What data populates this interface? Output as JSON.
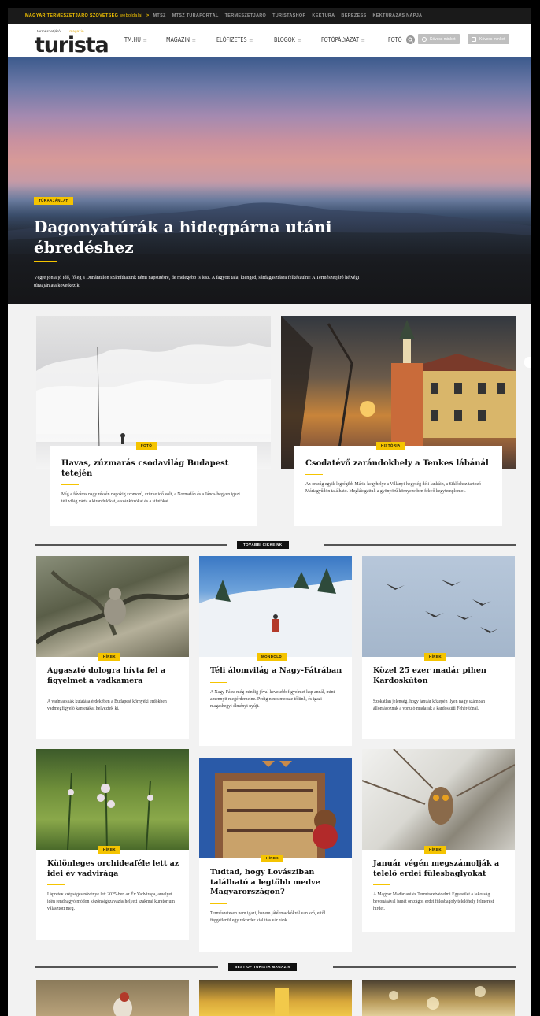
{
  "topbar": {
    "brand": "MAGYAR TERMÉSZETJÁRÓ SZÖVETSÉG",
    "brand_suffix": "weboldalai",
    "separator": ">",
    "links": [
      "MTSZ",
      "MTSZ TÚRAPORTÁL",
      "TERMÉSZETJÁRÓ",
      "TURISTASHOP",
      "KÉKTÚRA",
      "BEREZESS",
      "KÉKTÚRÁZÁS NAPJA"
    ]
  },
  "header": {
    "logo_tagline": "természetjáró",
    "logo_tagline_mag": "magazin",
    "logo_word": "turista",
    "nav": [
      {
        "label": "TM.HU",
        "chevron": "≡"
      },
      {
        "label": "MAGAZIN",
        "chevron": "≡"
      },
      {
        "label": "ELŐFIZETÉS",
        "chevron": "≡"
      },
      {
        "label": "BLOGOK",
        "chevron": "≡"
      },
      {
        "label": "FOTÓPÁLYÁZAT",
        "chevron": "≡"
      },
      {
        "label": "FOTÓ",
        "chevron": ""
      }
    ],
    "social": [
      {
        "label": "Kövess minket",
        "icon": "facebook-icon"
      },
      {
        "label": "Kövess minket",
        "icon": "instagram-icon"
      }
    ]
  },
  "hero": {
    "badge": "TÚRAAJÁNLAT",
    "title": "Dagonyatúrák a hidegpárna utáni ébredéshez",
    "lead": "Végre jön a jó idő, főleg a Dunántúlon számíthatunk némi napsütésre, de melegebb is lesz. A fagyott talaj kienged, sárdagasztásra felkészülni! A Természetjáró hétvégi túraajánlata következik."
  },
  "featured": [
    {
      "badge": "FOTÓ",
      "title": "Havas, zúzmarás csodavilág Budapest tetején",
      "lead": "Míg a főváros nagy részén napokig szomorú, szürke idő volt, a Normafán és a János-hegyen igazi téli világ várta a kirándulókat, a szánkózókat és a sífutókat."
    },
    {
      "badge": "HISTÓRIA",
      "title": "Csodatévő zarándokhely a Tenkes lábánál",
      "lead": "Az ország egyik legrégibb Mária-kegyhelye a Villányi-hegység déli lankáin, a Siklóshoz tartozó Máriagyűdön található. Meglátogattuk a gyönyörű környezetben fekvő kegytemplomot."
    }
  ],
  "section1": {
    "label": "TOVÁBBI CIKKEINK"
  },
  "grid": [
    {
      "badge": "HÍREK",
      "title": "Aggasztó dologra hívta fel a figyelmet a vadkamera",
      "lead": "A vadmacskák kutatása érdekében a Budapest környéki erdőkben vadmegfigyelő kamerákat helyeztek ki."
    },
    {
      "badge": "MONDOLD",
      "title": "Téli álomvilág a Nagy-Fátrában",
      "lead": "A Nagy-Fátra még mindig jóval kevesebb figyelmet kap annál, mint amennyit megérdemelne. Pedig nincs messze tőlünk, és igazi magashegyi élményt nyújt."
    },
    {
      "badge": "HÍREK",
      "title": "Közel 25 ezer madár pihen Kardoskúton",
      "lead": "Szokatlan jelenség, hogy január közepén ilyen nagy számban állomásoznak a vonuló madarak a kardoskúti Fehér-tónál."
    },
    {
      "badge": "HÍREK",
      "title": "Különleges orchideaféle lett az idei év vadvirága",
      "lead": "Lápréteк szépséges növénye lett 2025-ben az Év Vadvirága, amelyet idén rendhagyó módon közönségszavazás helyett szakmai kuratórium választott meg."
    },
    {
      "badge": "HÍREK",
      "title": "Tudtad, hogy Lovásziban található a legtöbb medve Magyarországon?",
      "lead": "Természetesen nem igazi, hanem játékmackókról van szó, ettől függetlenül egy rekorder kiállítás vár ránk."
    },
    {
      "badge": "HÍREK",
      "title": "Január végén megszámolják a telelő erdei fülesbaglyokat",
      "lead": "A Magyar Madártani és Természetvédelmi Egyesület a lakosság bevonásával ismét országos erdei fülesbagoly telelőhely felmérést hirdet."
    }
  ],
  "section2": {
    "label": "BEST OF TURISTA MAGAZIN"
  },
  "colors": {
    "accent": "#f5c400",
    "dark": "#111111",
    "bg": "#f2f2f2"
  }
}
